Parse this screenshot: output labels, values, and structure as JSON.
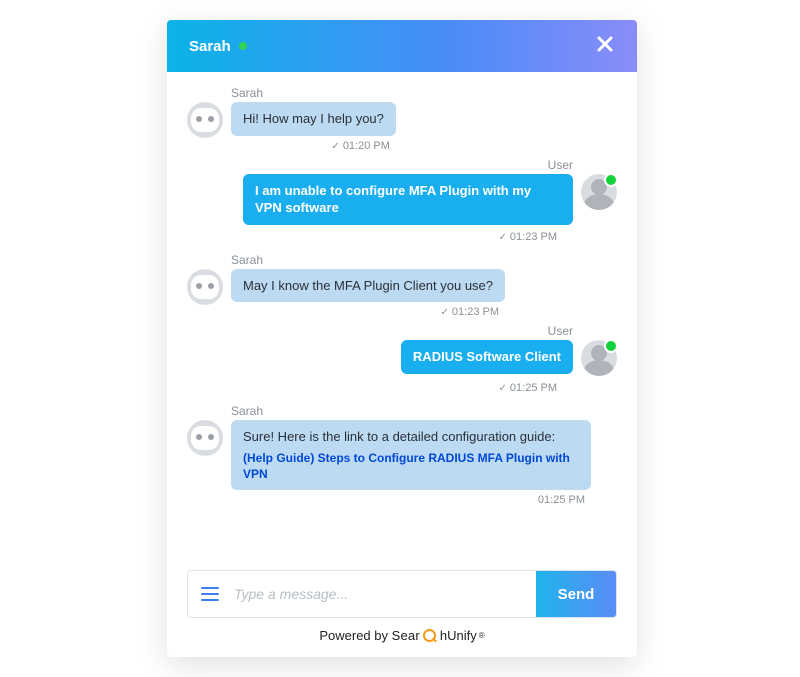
{
  "header": {
    "agent_name": "Sarah"
  },
  "labels": {
    "bot": "Sarah",
    "user": "User"
  },
  "messages": [
    {
      "from": "bot",
      "text": "Hi! How may I help you?",
      "time": "01:20 PM",
      "tick": true
    },
    {
      "from": "user",
      "text": "I am unable to configure MFA Plugin with my VPN software",
      "time": "01:23 PM",
      "tick": true
    },
    {
      "from": "bot",
      "text": "May I know the MFA Plugin Client you use?",
      "time": "01:23 PM",
      "tick": true
    },
    {
      "from": "user",
      "text": "RADIUS Software Client",
      "time": "01:25 PM",
      "tick": true
    },
    {
      "from": "bot",
      "text": "Sure! Here is the link to a detailed configuration guide:",
      "link": "(Help Guide) Steps to Configure RADIUS MFA Plugin with VPN",
      "time": "01:25 PM",
      "tick": false
    }
  ],
  "input": {
    "placeholder": "Type a message...",
    "send_label": "Send"
  },
  "footer": {
    "powered_by": "Powered by",
    "brand_left": "Sear",
    "brand_right": "hUnify"
  }
}
